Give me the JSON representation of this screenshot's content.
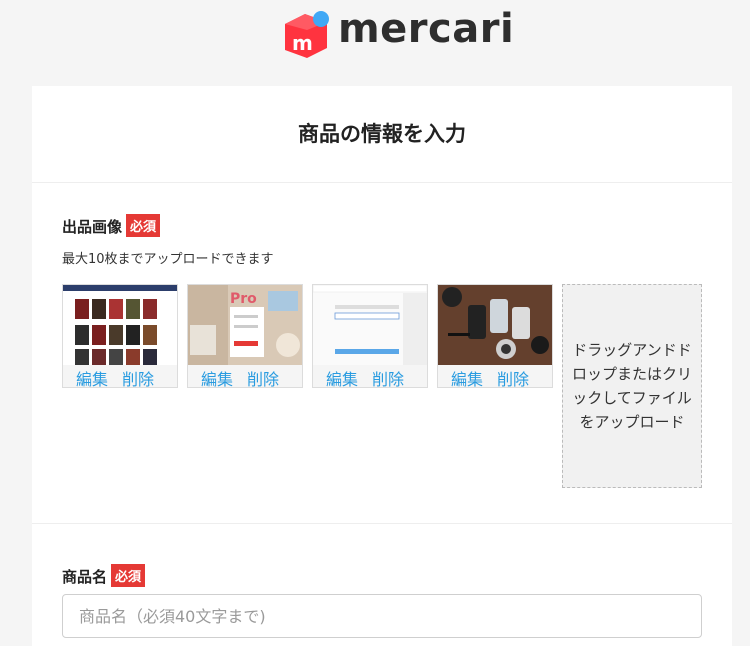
{
  "brand": {
    "name": "mercari",
    "accent": "#ff333f",
    "dot": "#40a8f5"
  },
  "page": {
    "title": "商品の情報を入力"
  },
  "images_section": {
    "label": "出品画像",
    "required_badge": "必須",
    "hint": "最大10枚までアップロードできます",
    "thumbnails": [
      {
        "edit_label": "編集",
        "delete_label": "削除",
        "alt": "movie posters page"
      },
      {
        "edit_label": "編集",
        "delete_label": "削除",
        "alt": "Progate form on desk"
      },
      {
        "edit_label": "編集",
        "delete_label": "削除",
        "alt": "white form page"
      },
      {
        "edit_label": "編集",
        "delete_label": "削除",
        "alt": "phones and camera on wood"
      }
    ],
    "dropzone_text": "ドラッグアンドドロップまたはクリックしてファイルをアップロード"
  },
  "name_section": {
    "label": "商品名",
    "required_badge": "必須",
    "placeholder": "商品名（必須40文字まで)"
  }
}
